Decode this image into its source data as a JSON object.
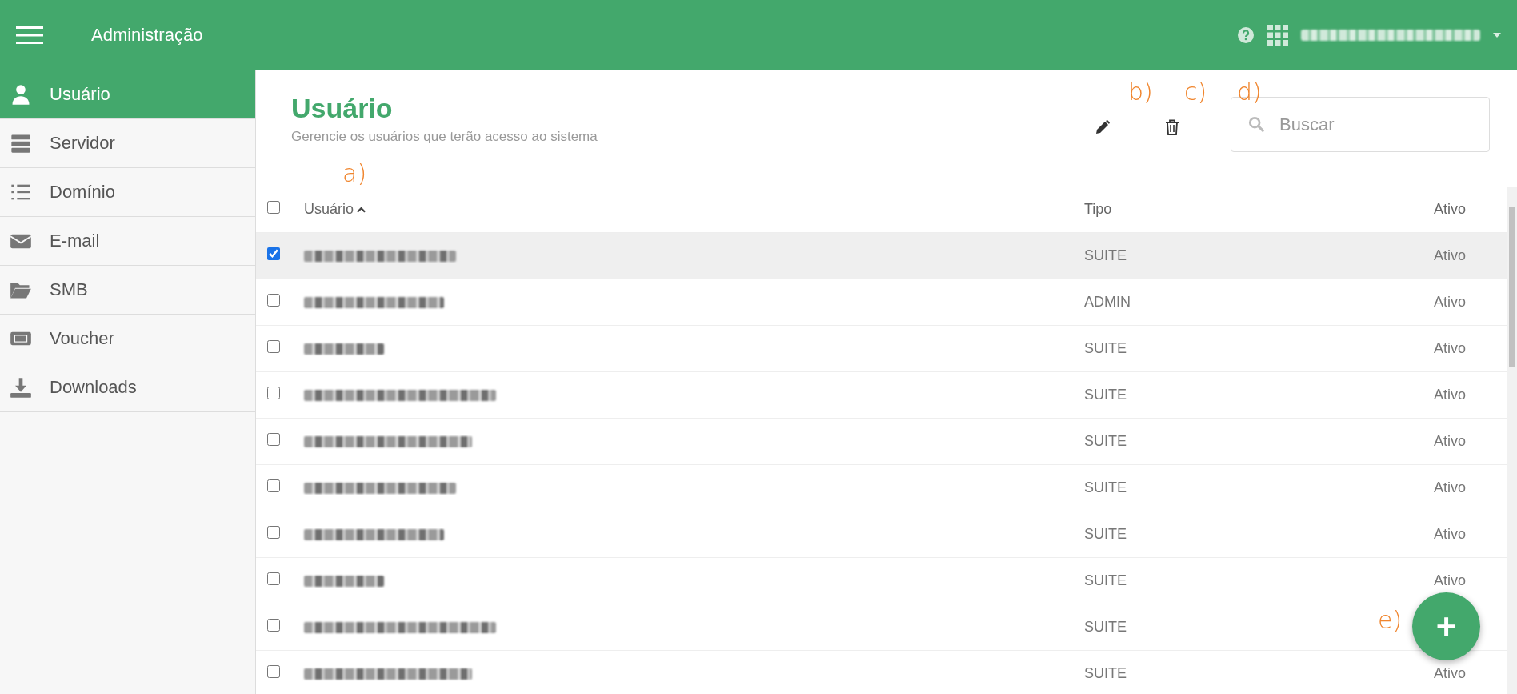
{
  "app_bar": {
    "title": "Administração"
  },
  "sidebar": {
    "items": [
      {
        "label": "Usuário",
        "selected": true
      },
      {
        "label": "Servidor",
        "selected": false
      },
      {
        "label": "Domínio",
        "selected": false
      },
      {
        "label": "E-mail",
        "selected": false
      },
      {
        "label": "SMB",
        "selected": false
      },
      {
        "label": "Voucher",
        "selected": false
      },
      {
        "label": "Downloads",
        "selected": false
      }
    ]
  },
  "page": {
    "title": "Usuário",
    "subtitle": "Gerencie os usuários que terão acesso ao sistema"
  },
  "toolbar": {
    "edit_annotation": "b)",
    "delete_annotation": "c)",
    "search": {
      "placeholder": "Buscar",
      "annotation": "d)"
    }
  },
  "table": {
    "select_all_checked": false,
    "columns": [
      {
        "label": "Usuário",
        "sorted": true,
        "annotation": "a)"
      },
      {
        "label": "Tipo"
      },
      {
        "label": "Ativo"
      }
    ],
    "rows": [
      {
        "checked": true,
        "tipo": "SUITE",
        "ativo": "Ativo"
      },
      {
        "checked": false,
        "tipo": "ADMIN",
        "ativo": "Ativo"
      },
      {
        "checked": false,
        "tipo": "SUITE",
        "ativo": "Ativo"
      },
      {
        "checked": false,
        "tipo": "SUITE",
        "ativo": "Ativo"
      },
      {
        "checked": false,
        "tipo": "SUITE",
        "ativo": "Ativo"
      },
      {
        "checked": false,
        "tipo": "SUITE",
        "ativo": "Ativo"
      },
      {
        "checked": false,
        "tipo": "SUITE",
        "ativo": "Ativo"
      },
      {
        "checked": false,
        "tipo": "SUITE",
        "ativo": "Ativo"
      },
      {
        "checked": false,
        "tipo": "SUITE"
      },
      {
        "checked": false,
        "tipo": "SUITE",
        "ativo": "Ativo"
      }
    ]
  },
  "fab": {
    "label": "+",
    "annotation": "e)"
  }
}
